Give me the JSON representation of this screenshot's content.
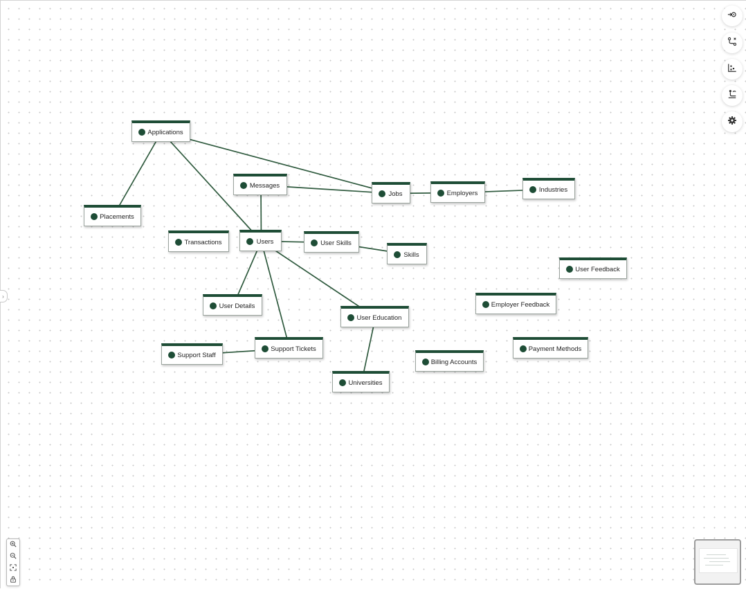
{
  "diagram": {
    "nodes": [
      {
        "id": "applications",
        "label": "Applications"
      },
      {
        "id": "placements",
        "label": "Placements"
      },
      {
        "id": "messages",
        "label": "Messages"
      },
      {
        "id": "jobs",
        "label": "Jobs"
      },
      {
        "id": "employers",
        "label": "Employers"
      },
      {
        "id": "industries",
        "label": "Industries"
      },
      {
        "id": "transactions",
        "label": "Transactions"
      },
      {
        "id": "users",
        "label": "Users"
      },
      {
        "id": "user_skills",
        "label": "User Skills"
      },
      {
        "id": "skills",
        "label": "Skills"
      },
      {
        "id": "user_feedback",
        "label": "User Feedback"
      },
      {
        "id": "user_details",
        "label": "User Details"
      },
      {
        "id": "user_education",
        "label": "User Education"
      },
      {
        "id": "employer_feedback",
        "label": "Employer Feedback"
      },
      {
        "id": "support_staff",
        "label": "Support Staff"
      },
      {
        "id": "support_tickets",
        "label": "Support Tickets"
      },
      {
        "id": "billing_accounts",
        "label": "Billing Accounts"
      },
      {
        "id": "payment_methods",
        "label": "Payment Methods"
      },
      {
        "id": "universities",
        "label": "Universities"
      }
    ],
    "edges": [
      [
        "applications",
        "placements"
      ],
      [
        "applications",
        "users"
      ],
      [
        "applications",
        "jobs"
      ],
      [
        "messages",
        "jobs"
      ],
      [
        "messages",
        "users"
      ],
      [
        "jobs",
        "employers"
      ],
      [
        "employers",
        "industries"
      ],
      [
        "users",
        "user_skills"
      ],
      [
        "user_skills",
        "skills"
      ],
      [
        "users",
        "user_details"
      ],
      [
        "users",
        "support_tickets"
      ],
      [
        "users",
        "user_education"
      ],
      [
        "support_staff",
        "support_tickets"
      ],
      [
        "user_education",
        "universities"
      ]
    ]
  },
  "toolbar": {
    "buttons": [
      {
        "icon": "commit-arrow-icon"
      },
      {
        "icon": "route-icon"
      },
      {
        "icon": "scatter-layout-icon"
      },
      {
        "icon": "tree-layout-icon"
      },
      {
        "icon": "gear-icon"
      }
    ]
  },
  "zoom_controls": [
    "zoom-in-icon",
    "zoom-out-icon",
    "fit-view-icon",
    "lock-icon"
  ],
  "colors": {
    "node_accent": "#1e4d36",
    "edge": "#2f5a3e"
  }
}
